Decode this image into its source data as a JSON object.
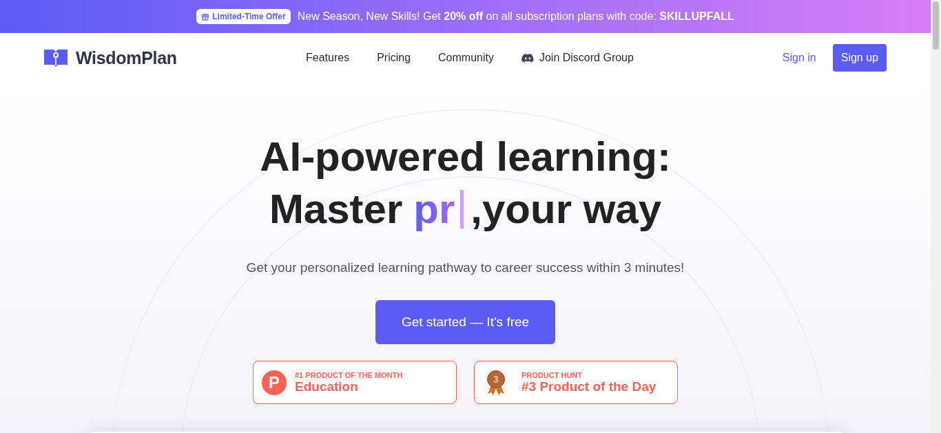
{
  "banner": {
    "badge": "Limited-Time Offer",
    "message": "New Season, New Skills! Get **20% off** on all subscription plans with code: **SKILLUPFALL**"
  },
  "nav": {
    "logo": "WisdomPlan",
    "links": [
      {
        "label": "Features",
        "kind": "text"
      },
      {
        "label": "Pricing",
        "kind": "text"
      },
      {
        "label": "Community",
        "kind": "text"
      },
      {
        "label": "Join Discord Group",
        "kind": "discord"
      }
    ],
    "sign_in": "Sign in",
    "sign_up": "Sign up"
  },
  "hero": {
    "line_1": "AI-powered learning:",
    "line_2_start": "Master",
    "typed": "pr",
    "cursor_visible": true,
    "line_2_end": ",your way",
    "subtitle": "Get your personalized learning pathway to career success within 3 minutes!",
    "cta": "Get started — It's free"
  },
  "awards": [
    {
      "kind": "producthunt",
      "icon_text": "P",
      "label": "#1 PRODUCT OF THE MONTH",
      "title": "Education"
    },
    {
      "kind": "medal",
      "icon_text": "3",
      "label": "PRODUCT HUNT",
      "title": "#3 Product of the Day"
    }
  ]
}
